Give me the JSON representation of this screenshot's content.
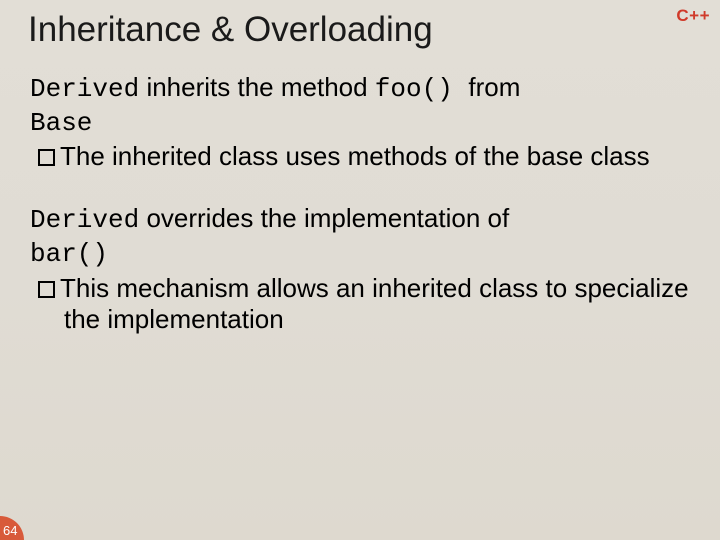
{
  "badge": "C++",
  "title": "Inheritance & Overloading",
  "p1_code1": "Derived",
  "p1_t1": " inherits the method ",
  "p1_code2": " foo() ",
  "p1_t2": " from ",
  "p1_code3": "Base",
  "p1_sub": "The inherited class uses methods of the base class",
  "p2_code1": "Derived",
  "p2_t1": " overrides the implementation of ",
  "p2_code2": "bar()",
  "p2_sub": "This mechanism allows an inherited class to specialize the implementation",
  "pagenum": "64"
}
